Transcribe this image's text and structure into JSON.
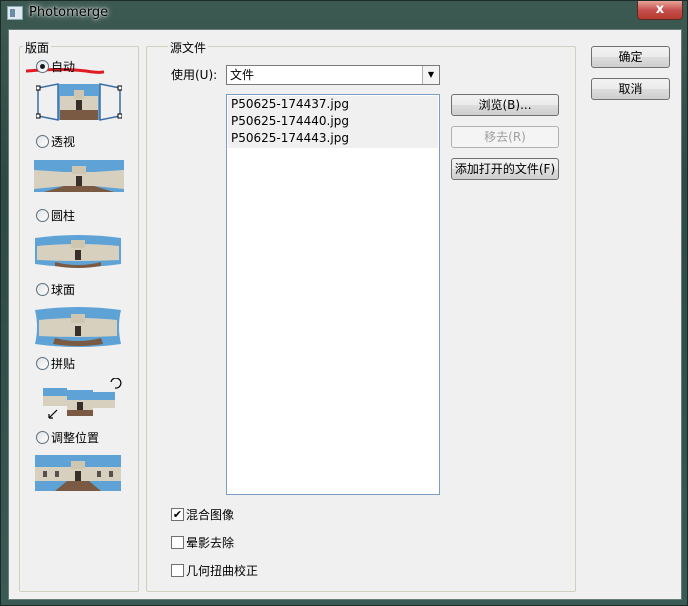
{
  "window": {
    "title": "Photomerge",
    "close_label": "x"
  },
  "layout_group": {
    "label": "版面",
    "options": [
      {
        "label": "自动",
        "checked": true
      },
      {
        "label": "透视",
        "checked": false
      },
      {
        "label": "圆柱",
        "checked": false
      },
      {
        "label": "球面",
        "checked": false
      },
      {
        "label": "拼贴",
        "checked": false
      },
      {
        "label": "调整位置",
        "checked": false
      }
    ]
  },
  "source_group": {
    "label": "源文件",
    "use_label": "使用(U):",
    "use_value": "文件",
    "files": [
      "P50625-174437.jpg",
      "P50625-174440.jpg",
      "P50625-174443.jpg"
    ],
    "browse_label": "浏览(B)...",
    "remove_label": "移去(R)",
    "add_open_label": "添加打开的文件(F)",
    "options": [
      {
        "label": "混合图像",
        "checked": true
      },
      {
        "label": "晕影去除",
        "checked": false
      },
      {
        "label": "几何扭曲校正",
        "checked": false
      }
    ]
  },
  "actions": {
    "ok_label": "确定",
    "cancel_label": "取消"
  },
  "colors": {
    "annotation_red": "#e11b22",
    "sky": "#5fa3d6"
  }
}
